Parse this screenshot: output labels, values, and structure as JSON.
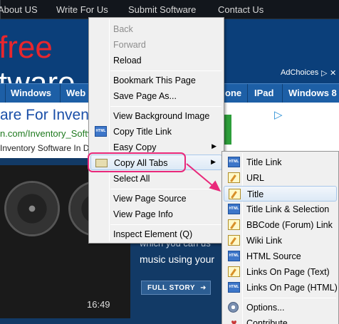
{
  "topnav": {
    "items": [
      "About US",
      "Write For Us",
      "Submit Software",
      "Contact Us"
    ]
  },
  "logo": {
    "line1": "free",
    "line2": "tware"
  },
  "adchoices": "AdChoices",
  "categories": [
    "Windows",
    "Web",
    "one",
    "IPad",
    "Windows 8"
  ],
  "ad": {
    "title": "are For Invent",
    "url": "n.com/Inventory_Softv",
    "desc": "Inventory Software In Del"
  },
  "hero": {
    "time": "16:49",
    "text1": "which you can us",
    "text2": "music using your",
    "button": "FULL STORY"
  },
  "menu": {
    "items": [
      {
        "label": "Back",
        "disabled": true
      },
      {
        "label": "Forward",
        "disabled": true
      },
      {
        "label": "Reload",
        "disabled": false
      },
      {
        "label": "Bookmark This Page",
        "disabled": false
      },
      {
        "label": "Save Page As...",
        "disabled": false
      },
      {
        "label": "View Background Image",
        "disabled": false
      },
      {
        "label": "Copy Title Link",
        "disabled": false,
        "icon": "html-icon"
      },
      {
        "label": "Easy Copy",
        "disabled": false,
        "submenu": true
      },
      {
        "label": "Copy All Tabs",
        "disabled": false,
        "submenu": true,
        "icon": "folder-icon"
      },
      {
        "label": "Select All",
        "disabled": false
      },
      {
        "label": "View Page Source",
        "disabled": false
      },
      {
        "label": "View Page Info",
        "disabled": false
      },
      {
        "label": "Inspect Element (Q)",
        "disabled": false
      }
    ]
  },
  "submenu": {
    "items": [
      {
        "label": "Title Link",
        "icon": "html-icon"
      },
      {
        "label": "URL",
        "icon": "note-icon"
      },
      {
        "label": "Title",
        "icon": "note-icon"
      },
      {
        "label": "Title Link & Selection",
        "icon": "html-icon"
      },
      {
        "label": "BBCode (Forum) Link",
        "icon": "note-icon"
      },
      {
        "label": "Wiki Link",
        "icon": "note-icon"
      },
      {
        "label": "HTML Source",
        "icon": "html-icon"
      },
      {
        "label": "Links On Page (Text)",
        "icon": "note-icon"
      },
      {
        "label": "Links On Page (HTML)",
        "icon": "html-icon"
      },
      {
        "label": "Options...",
        "icon": "gear-icon"
      },
      {
        "label": "Contribute",
        "icon": "heart-icon"
      }
    ]
  },
  "colors": {
    "annotation": "#e9287a",
    "menu_bg": "#f0f0f0",
    "highlight_border": "#a9c7ea"
  }
}
